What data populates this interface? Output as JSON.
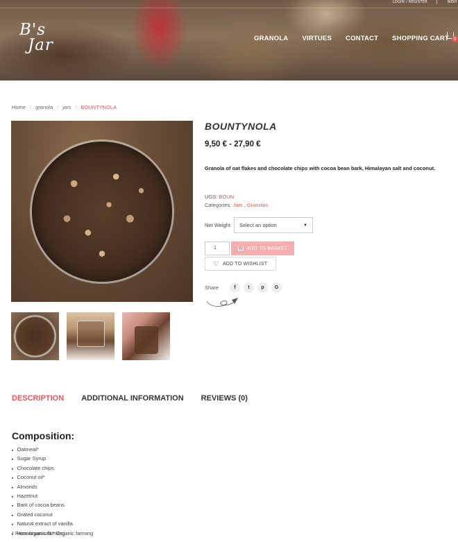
{
  "header": {
    "login_link": "LOGIN / REGISTER",
    "wishlist_link": "WISH",
    "logo_line1": "B's",
    "logo_line2": "Jar",
    "nav": [
      "GRANOLA",
      "VIRTUES",
      "CONTACT",
      "SHOPPING CART"
    ],
    "cart_count": "0"
  },
  "breadcrumb": {
    "items": [
      "Home",
      "granola",
      "jars"
    ],
    "separator": "/",
    "current": "BOUNTYNOLA"
  },
  "product": {
    "title": "BOUNTYNOLA",
    "price": "9,50 € - 27,90 €",
    "short_description": "Granola of oat flakes and chocolate chips with cocoa bean bark, Himalayan salt and coconut.",
    "sku_label": "UGS:",
    "sku": "BOUN",
    "categories_label": "Categories:",
    "categories": [
      "Jars",
      "Granolas"
    ],
    "categories_separator": ",",
    "variation_label": "Net Weight",
    "variation_placeholder": "Select an option",
    "quantity": "1",
    "add_to_basket": "ADD TO BASKET",
    "add_to_wishlist": "ADD TO WISHLIST",
    "share_label": "Share",
    "social": [
      "f",
      "t",
      "p",
      "G"
    ]
  },
  "tabs": [
    "DESCRIPTION",
    "ADDITIONAL INFORMATION",
    "REVIEWS (0)"
  ],
  "description": {
    "heading": "Composition:",
    "ingredients": [
      "Oatmeal*",
      "Sugar Syrup",
      "Chocolate chips",
      "Coconut oil*",
      "Almonds",
      "Hazelnut",
      "Bark of cocoa beans",
      "Grated coconut",
      "Natural extract of vanilla",
      "Himalayan salt * Organic farming"
    ],
    "footnote": "* From organic farming"
  },
  "colors": {
    "accent": "#e8565a",
    "basket_button": "#f5aeb0"
  }
}
